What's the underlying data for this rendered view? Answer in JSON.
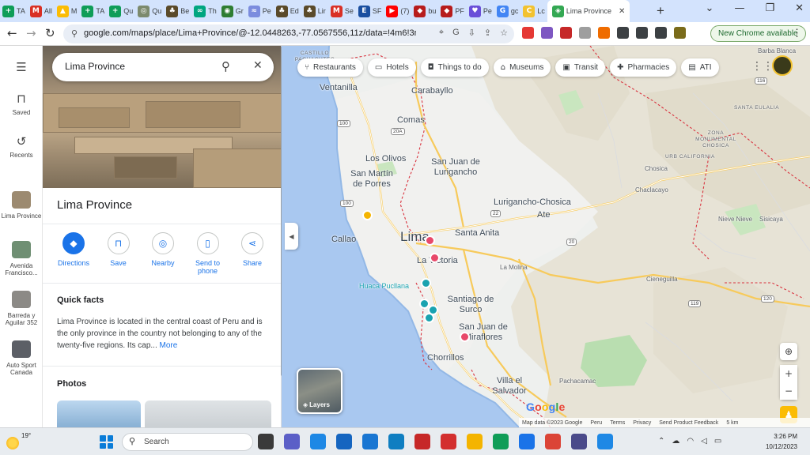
{
  "browser": {
    "tabs": [
      {
        "title": "TA",
        "icon": "sheets-icon",
        "color": "#0f9d58",
        "glyph": "+"
      },
      {
        "title": "All",
        "icon": "gmail-icon",
        "color": "#d93025",
        "glyph": "M"
      },
      {
        "title": "M",
        "icon": "drive-icon",
        "color": "#fbbc04",
        "glyph": "▲"
      },
      {
        "title": "TA",
        "icon": "sheets-icon",
        "color": "#0f9d58",
        "glyph": "+"
      },
      {
        "title": "Qu",
        "icon": "sheets-icon",
        "color": "#0f9d58",
        "glyph": "+"
      },
      {
        "title": "Qu",
        "icon": "site-icon",
        "color": "#7c8a6d",
        "glyph": "◎"
      },
      {
        "title": "Be",
        "icon": "site-icon",
        "color": "#5a4a2a",
        "glyph": "♣"
      },
      {
        "title": "Th",
        "icon": "tripadvisor-icon",
        "color": "#00a680",
        "glyph": "∞"
      },
      {
        "title": "Gr",
        "icon": "site-icon",
        "color": "#2e7d32",
        "glyph": "◉"
      },
      {
        "title": "Pe",
        "icon": "site-icon",
        "color": "#7b8cde",
        "glyph": "≈"
      },
      {
        "title": "Ed",
        "icon": "site-icon",
        "color": "#5a4a2a",
        "glyph": "♣"
      },
      {
        "title": "Lir",
        "icon": "site-icon",
        "color": "#5a4a2a",
        "glyph": "♣"
      },
      {
        "title": "Se",
        "icon": "gmail-icon",
        "color": "#d93025",
        "glyph": "M"
      },
      {
        "title": "SF",
        "icon": "site-icon",
        "color": "#1a4fa0",
        "glyph": "E"
      },
      {
        "title": "(7)",
        "icon": "youtube-icon",
        "color": "#ff0000",
        "glyph": "▶"
      },
      {
        "title": "bu",
        "icon": "site-icon",
        "color": "#b71c1c",
        "glyph": "◆"
      },
      {
        "title": "PF",
        "icon": "site-icon",
        "color": "#b71c1c",
        "glyph": "◆"
      },
      {
        "title": "Pe",
        "icon": "site-icon",
        "color": "#6a4fd8",
        "glyph": "♥"
      },
      {
        "title": "gc",
        "icon": "google-icon",
        "color": "#4285f4",
        "glyph": "G"
      },
      {
        "title": "Lc",
        "icon": "site-icon",
        "color": "#f2c230",
        "glyph": "C"
      },
      {
        "title": "Lima Province",
        "icon": "maps-icon",
        "color": "#34a853",
        "glyph": "◈",
        "active": true
      }
    ],
    "window_controls": [
      "⌄",
      "—",
      "❐",
      "✕"
    ],
    "url": "google.com/maps/place/Lima+Province/@-12.0448263,-77.0567556,11z/data=!4m6!3m...",
    "update_chip": "New Chrome available",
    "ext_colors": [
      "#e53935",
      "#7e57c2",
      "#c62828",
      "#9e9e9e",
      "#ef6c00",
      "#3c4043",
      "#3c4043",
      "#3c4043",
      "#7a6b1a"
    ]
  },
  "rail": {
    "saved": "Saved",
    "recents": "Recents",
    "recent_items": [
      {
        "label": "Lima Province",
        "color": "#9c8a70"
      },
      {
        "label": "Avenida Francisco...",
        "color": "#6f8f73"
      },
      {
        "label": "Barreda y Aguilar 352",
        "color": "#8c8a86"
      },
      {
        "label": "Auto Sport Canada",
        "color": "#5c5f66"
      }
    ]
  },
  "panel": {
    "search_value": "Lima Province",
    "title": "Lima Province",
    "actions": [
      "Directions",
      "Save",
      "Nearby",
      "Send to phone",
      "Share"
    ],
    "quick_facts_heading": "Quick facts",
    "quick_facts_text": "Lima Province is located in the central coast of Peru and is the only province in the country not belonging to any of the twenty-five regions. Its cap...",
    "quick_facts_more": "More",
    "photos_heading": "Photos"
  },
  "map": {
    "chips": [
      {
        "label": "Restaurants",
        "icon": "fork-knife-icon",
        "glyph": "⑂"
      },
      {
        "label": "Hotels",
        "icon": "bed-icon",
        "glyph": "▭"
      },
      {
        "label": "Things to do",
        "icon": "camera-icon",
        "glyph": "◘"
      },
      {
        "label": "Museums",
        "icon": "museum-icon",
        "glyph": "⌂"
      },
      {
        "label": "Transit",
        "icon": "bus-icon",
        "glyph": "▣"
      },
      {
        "label": "Pharmacies",
        "icon": "pharmacy-icon",
        "glyph": "✚"
      },
      {
        "label": "ATI",
        "icon": "atm-icon",
        "glyph": "▤"
      }
    ],
    "cities": [
      "Ventanilla",
      "Carabayllo",
      "Comas",
      "Los Olivos",
      "San Juan de Lurigancho",
      "San Martín de Porres",
      "Lurigancho-Chosica",
      "Ate",
      "Callao",
      "Lima",
      "Santa Anita",
      "La Victoria",
      "Santiago de Surco",
      "San Juan de Miraflores",
      "Chorrillos",
      "Villa el Salvador"
    ],
    "towns": [
      "Chosica",
      "Chaclacayo",
      "Nieve Nieve",
      "Sisicaya",
      "Barba Blanca",
      "La Molina",
      "Cieneguilla",
      "Pachacamac"
    ],
    "regions": [
      "SANTA EULALIA",
      "ZONA MONUMENTAL CHOSICA",
      "URB CALIFORNIA",
      "CASTILLO PACHACUTEC"
    ],
    "poi": "Huaca Pucllana",
    "layers": "Layers",
    "attribution": [
      "Map data ©2023 Google",
      "Peru",
      "Terms",
      "Privacy",
      "Send Product Feedback",
      "5 km"
    ]
  },
  "taskbar": {
    "temperature": "19°",
    "search_label": "Search",
    "time": "3:26 PM",
    "date": "10/12/2023",
    "app_colors": [
      "#3a3a3a",
      "#5b5fc7",
      "#1e88e5",
      "#1565c0",
      "#1976d2",
      "#0f7ec1",
      "#c62828",
      "#d32f2f",
      "#f4b400",
      "#0f9d58",
      "#1a73e8",
      "#db4437",
      "#4a4a8a",
      "#1e88e5"
    ]
  }
}
